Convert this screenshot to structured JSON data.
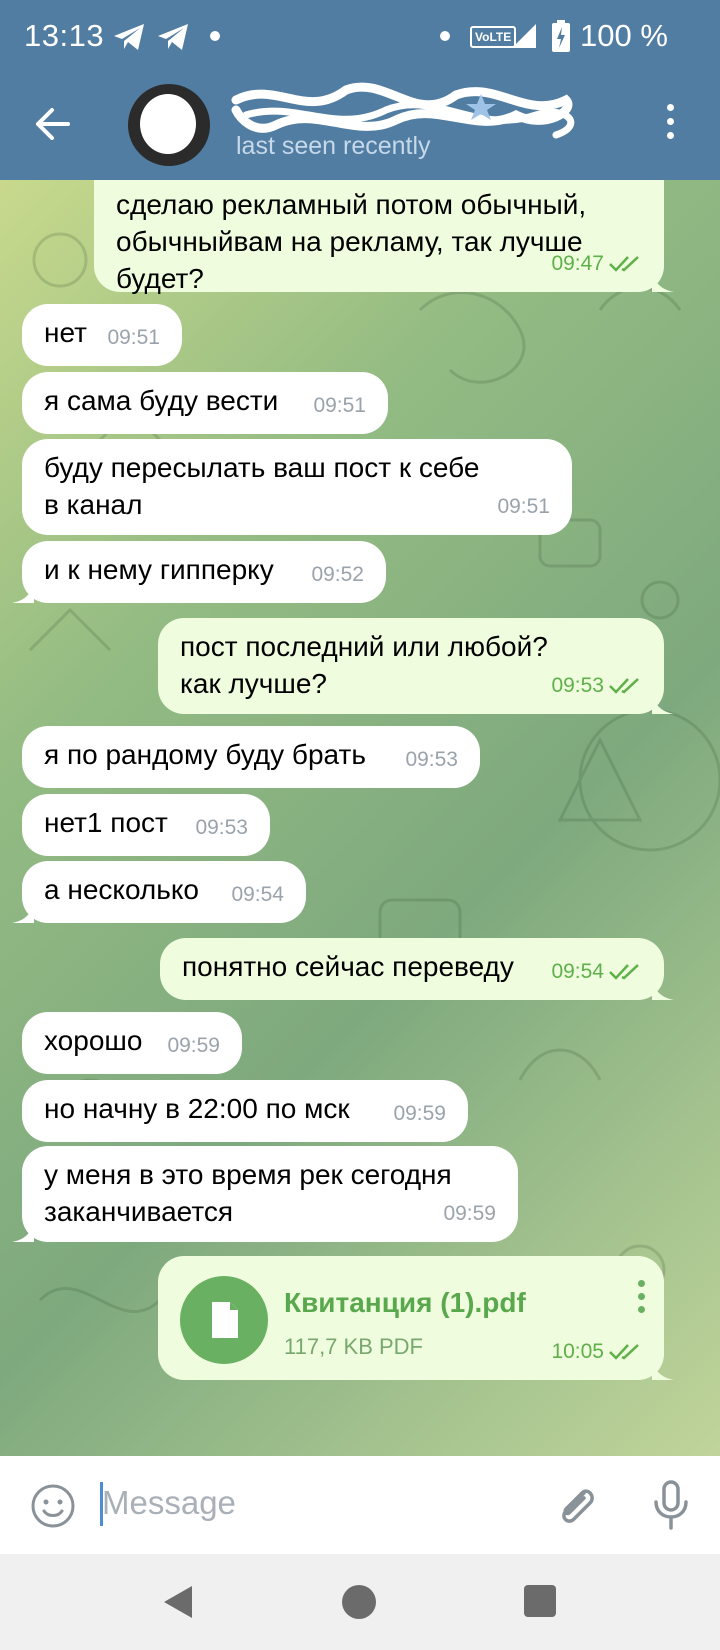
{
  "status_bar": {
    "time": "13:13",
    "volte": "VoLTE",
    "battery": "100 %"
  },
  "header": {
    "subtitle": "last seen recently"
  },
  "messages": [
    {
      "dir": "out",
      "text": "сделаю рекламный потом обычный, обычныйвам на рекламу, так лучше будет?",
      "time": "09:47"
    },
    {
      "dir": "in",
      "text": "нет",
      "time": "09:51"
    },
    {
      "dir": "in",
      "text": "я сама буду вести",
      "time": "09:51"
    },
    {
      "dir": "in",
      "text": "буду пересылать ваш пост к себе в канал",
      "time": "09:51"
    },
    {
      "dir": "in",
      "text": "и к нему гипперку",
      "time": "09:52"
    },
    {
      "dir": "out",
      "text": "пост последний или любой? как лучше?",
      "time": "09:53"
    },
    {
      "dir": "in",
      "text": "я по рандому буду брать",
      "time": "09:53"
    },
    {
      "dir": "in",
      "text": "нет1 пост",
      "time": "09:53"
    },
    {
      "dir": "in",
      "text": "а несколько",
      "time": "09:54"
    },
    {
      "dir": "out",
      "text": "понятно сейчас переведу",
      "time": "09:54"
    },
    {
      "dir": "in",
      "text": "хорошо",
      "time": "09:59"
    },
    {
      "dir": "in",
      "text": "но начну в 22:00 по мск",
      "time": "09:59"
    },
    {
      "dir": "in",
      "text": "у меня в это время рек сегодня заканчивается",
      "time": "09:59"
    }
  ],
  "file_message": {
    "name": "Квитанция (1).pdf",
    "size": "117,7 KB PDF",
    "time": "10:05"
  },
  "composer": {
    "placeholder": "Message"
  },
  "colors": {
    "header": "#517da2",
    "outgoing": "#effdde",
    "incoming": "#ffffff",
    "accent_green": "#5fb04a"
  }
}
